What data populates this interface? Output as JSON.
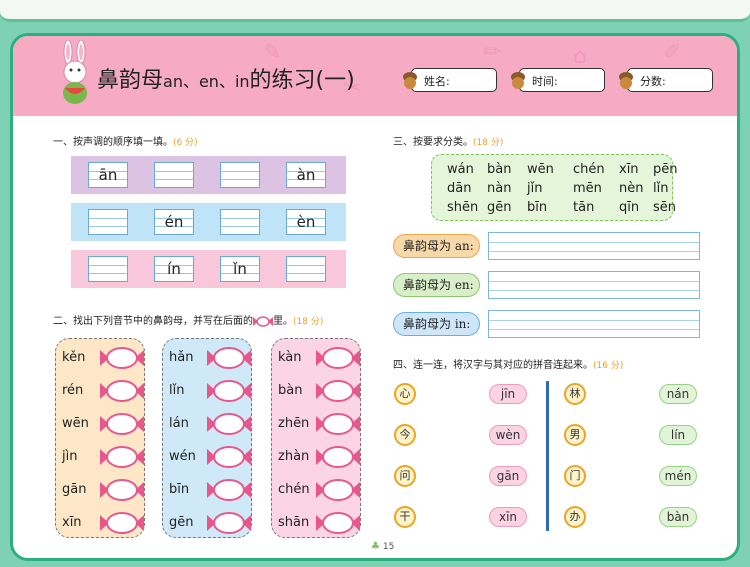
{
  "header": {
    "title_main": "鼻韵母",
    "title_finals": "an、en、in",
    "title_suffix": "的练习(一)",
    "name_label": "姓名:",
    "time_label": "时间:",
    "score_label": "分数:"
  },
  "q1": {
    "title": "一、按声调的顺序填一填。",
    "points": "(6 分)",
    "rows": [
      {
        "color": "#dcc3e3",
        "cells": [
          "ān",
          "",
          "",
          "àn"
        ]
      },
      {
        "color": "#bfe3f7",
        "cells": [
          "",
          "én",
          "",
          "èn"
        ]
      },
      {
        "color": "#f8c8da",
        "cells": [
          "",
          "ín",
          "ǐn",
          ""
        ]
      }
    ]
  },
  "q2": {
    "title_before": "二、找出下列音节中的鼻韵母，并写在后面的",
    "title_after": "里。",
    "points": "(18 分)",
    "panels": [
      {
        "color": "#fde7c7",
        "items": [
          "kěn",
          "rén",
          "wēn",
          "jìn",
          "gān",
          "xīn"
        ]
      },
      {
        "color": "#cfe9f9",
        "items": [
          "hǎn",
          "lǐn",
          "lán",
          "wén",
          "bīn",
          "gēn"
        ]
      },
      {
        "color": "#fbd5e3",
        "items": [
          "kàn",
          "bàn",
          "zhēn",
          "zhàn",
          "chén",
          "shān"
        ]
      }
    ]
  },
  "q3": {
    "title": "三、按要求分类。",
    "points": "(18 分)",
    "pinyin_rows": [
      [
        "wán",
        "bàn",
        "wēn",
        "chén",
        "xīn",
        "pēn"
      ],
      [
        "dān",
        "nàn",
        "jǐn",
        "mēn",
        "nèn",
        "lǐn"
      ],
      [
        "shēn",
        "gēn",
        "bīn",
        "tān",
        "qīn",
        "sēn"
      ]
    ],
    "categories": [
      {
        "label": "鼻韵母为 an:",
        "color": "#f7d8a8",
        "border": "#e8a84a"
      },
      {
        "label": "鼻韵母为 en:",
        "color": "#d9efc9",
        "border": "#8cc86c"
      },
      {
        "label": "鼻韵母为 in:",
        "color": "#cfe6f8",
        "border": "#6aaee0"
      }
    ]
  },
  "q4": {
    "title": "四、连一连，将汉字与其对应的拼音连起来。",
    "points": "(16 分)",
    "left_chars": [
      "心",
      "今",
      "问",
      "干"
    ],
    "left_pinyin": [
      "jīn",
      "wèn",
      "gān",
      "xīn"
    ],
    "right_chars": [
      "林",
      "男",
      "门",
      "办"
    ],
    "right_pinyin": [
      "nán",
      "lín",
      "mén",
      "bàn"
    ]
  },
  "page_number": "15"
}
